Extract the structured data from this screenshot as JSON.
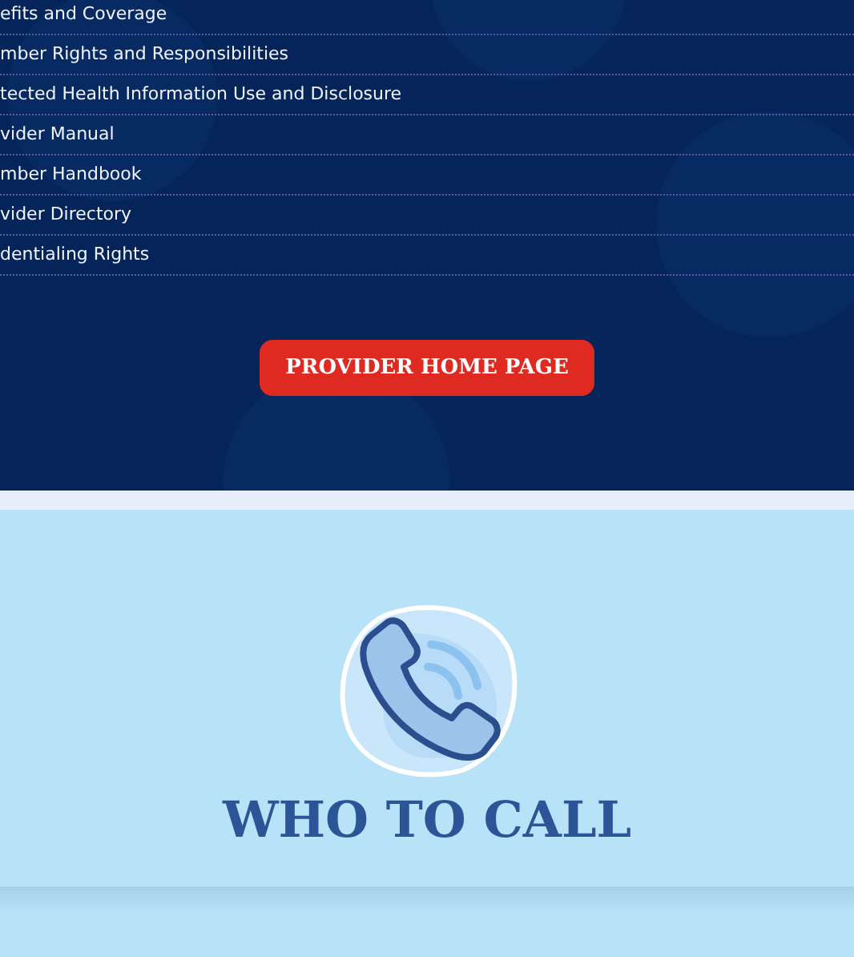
{
  "document_links": [
    {
      "label": "efits and Coverage"
    },
    {
      "label": "mber Rights and Responsibilities"
    },
    {
      "label": "tected Health Information Use and Disclosure"
    },
    {
      "label": "vider Manual"
    },
    {
      "label": "mber Handbook"
    },
    {
      "label": "vider Directory"
    },
    {
      "label": "dentialing Rights"
    }
  ],
  "provider_button": {
    "label": "PROVIDER HOME PAGE"
  },
  "who_to_call": {
    "heading": "WHO TO CALL"
  }
}
